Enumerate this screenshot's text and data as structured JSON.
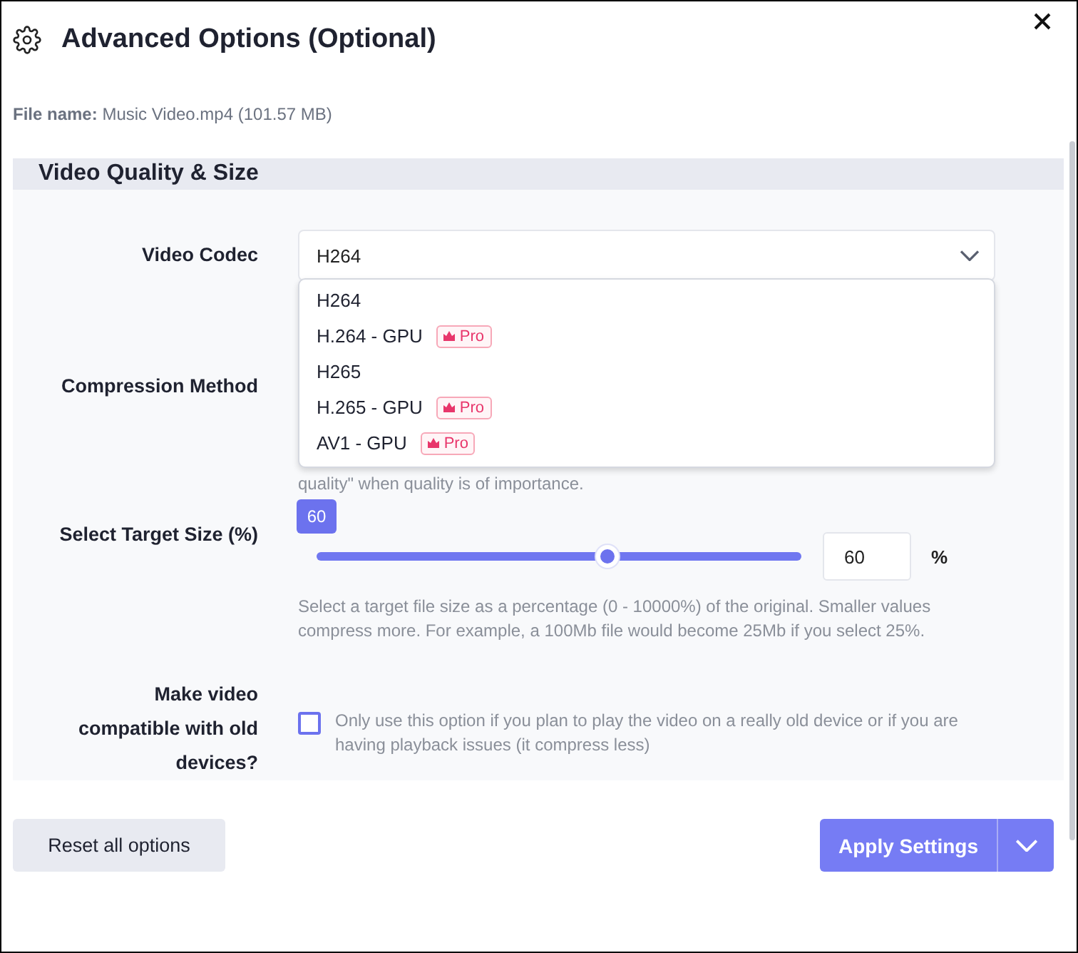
{
  "dialog": {
    "title": "Advanced Options (Optional)",
    "file_label": "File name:",
    "file_value": "Music Video.mp4 (101.57 MB)"
  },
  "section": {
    "title": "Video Quality & Size"
  },
  "codec": {
    "label": "Video Codec",
    "value": "H264",
    "expanded": true,
    "options": [
      {
        "label": "H264"
      },
      {
        "label": "H.264 - GPU",
        "badge": "Pro"
      },
      {
        "label": "H265"
      },
      {
        "label": "H.265 - GPU",
        "badge": "Pro"
      },
      {
        "label": "AV1 - GPU",
        "badge": "Pro"
      }
    ]
  },
  "compression": {
    "label": "Compression Method",
    "help": "quality\" when quality is of importance."
  },
  "target_size": {
    "label": "Select Target Size (%)",
    "level": 0.6,
    "bubble": "60",
    "value": "60",
    "unit": "%",
    "help": "Select a target file size as a percentage (0 - 10000%) of the original. Smaller values compress more. For example, a 100Mb file would become 25Mb if you select 25%."
  },
  "compatible": {
    "label": "Make video compatible with old devices?",
    "checked": false,
    "help": "Only use this option if you plan to play the video on a really old device or if you are having playback issues (it compress less)"
  },
  "buttons": {
    "reset": "Reset all options",
    "apply": "Apply Settings"
  }
}
